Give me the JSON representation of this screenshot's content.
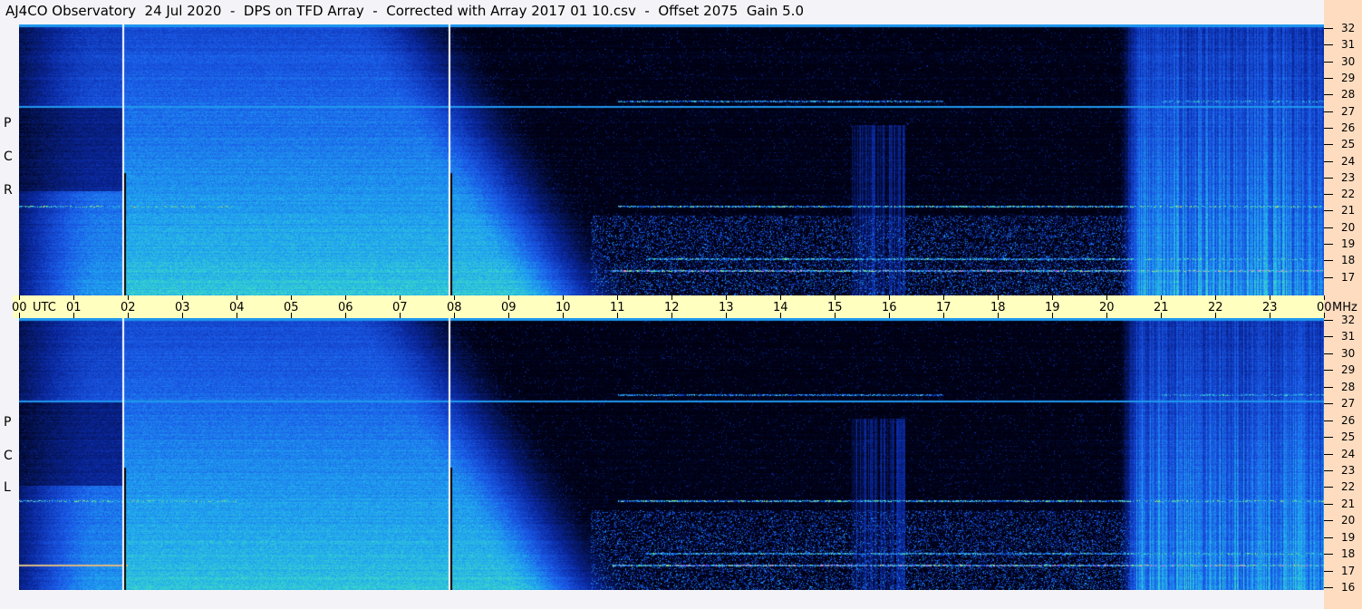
{
  "title": "AJ4CO Observatory  24 Jul 2020  -  DPS on TFD Array  -  Corrected with Array 2017 01 10.csv  -  Offset 2075  Gain 5.0",
  "top_panel": {
    "polarization_letters": [
      "R",
      "C",
      "P"
    ]
  },
  "bottom_panel": {
    "polarization_letters": [
      "L",
      "C",
      "P"
    ]
  },
  "time_axis": {
    "unit_label": "UTC",
    "freq_unit_label": "MHz"
  },
  "chart_data": {
    "type": "heatmap",
    "title": "AJ4CO Observatory 24 Jul 2020 - DPS on TFD Array",
    "xlabel": "UTC",
    "ylabel": "MHz",
    "x_ticks": [
      "00",
      "01",
      "02",
      "03",
      "04",
      "05",
      "06",
      "07",
      "08",
      "09",
      "10",
      "11",
      "12",
      "13",
      "14",
      "15",
      "16",
      "17",
      "18",
      "19",
      "20",
      "21",
      "22",
      "23",
      "00"
    ],
    "x_range": [
      0,
      24
    ],
    "y_ticks": [
      "32",
      "31",
      "30",
      "29",
      "28",
      "27",
      "26",
      "25",
      "24",
      "23",
      "22",
      "21",
      "20",
      "19",
      "18",
      "17",
      "16"
    ],
    "y_range": [
      16,
      32
    ],
    "panels": [
      "RCP",
      "LCP"
    ],
    "colormap": [
      "#000010",
      "#0a2aa0",
      "#1a5ae8",
      "#20a8f0",
      "#40e0c0",
      "#c0f040",
      "#ff60ff"
    ],
    "markers_utc": [
      1.9,
      7.9
    ],
    "interference_lines_mhz": [
      27.0,
      32.0
    ]
  }
}
